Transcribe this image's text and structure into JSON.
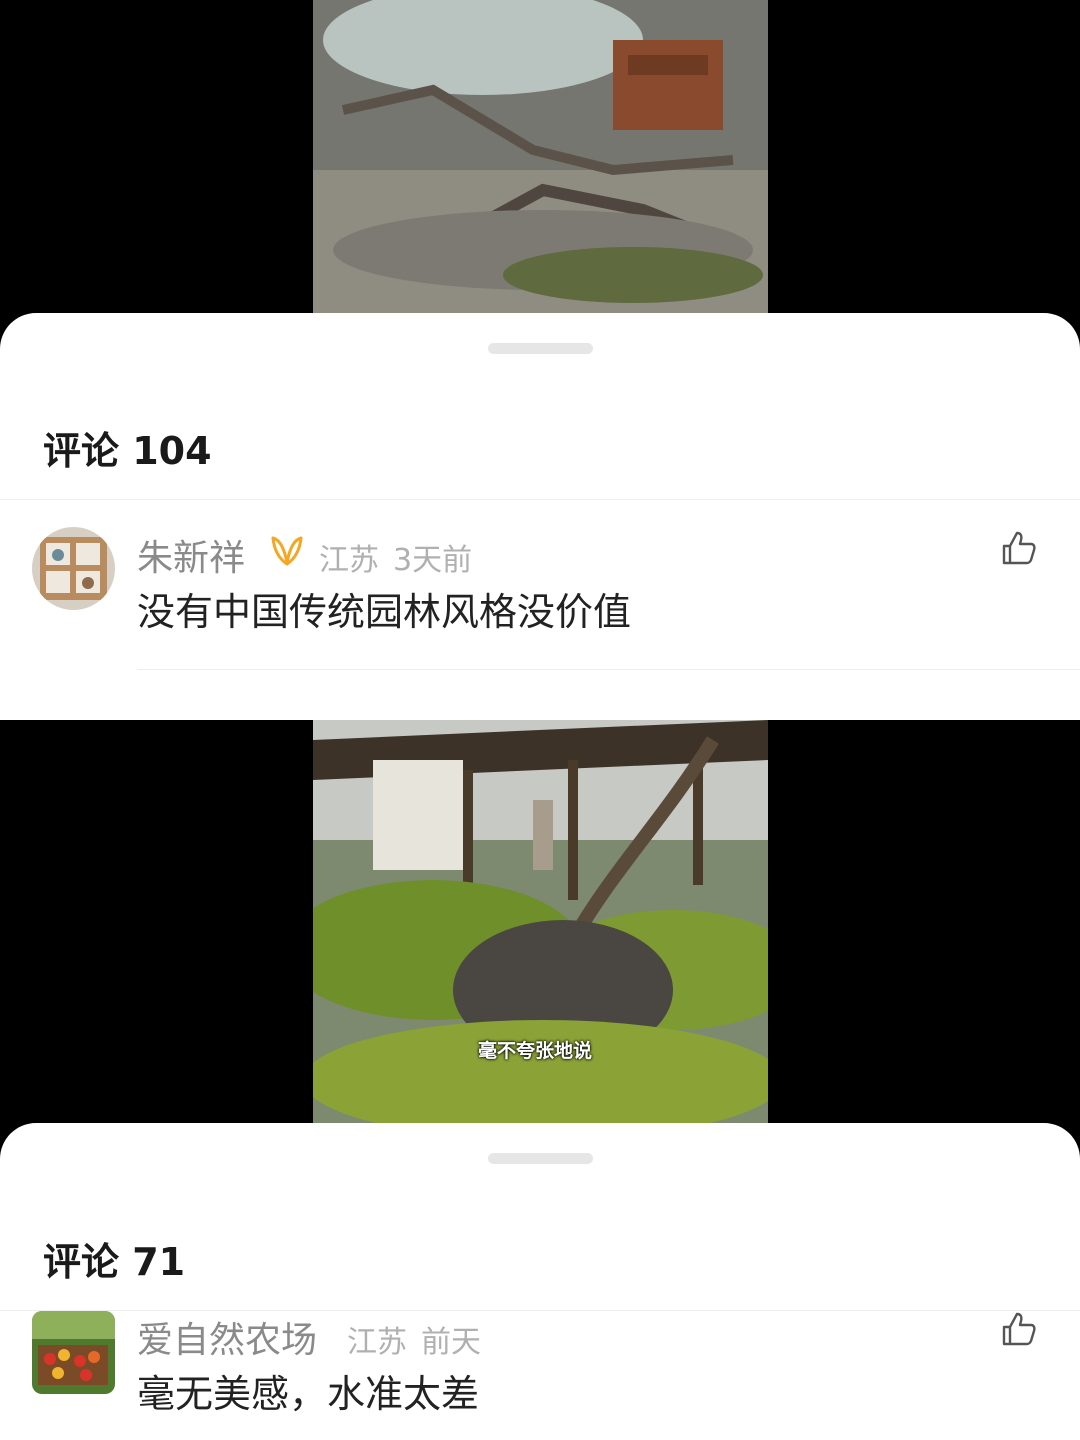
{
  "panel1": {
    "title": "评论 104",
    "comment": {
      "username": "朱新祥",
      "location": "江苏",
      "time": "3天前",
      "text": "没有中国传统园林风格没价值"
    }
  },
  "panel2": {
    "subtitle": "毫不夸张地说",
    "title": "评论 71",
    "comment": {
      "username": "爱自然农场",
      "location": "江苏",
      "time": "前天",
      "text": "毫无美感，水准太差"
    }
  },
  "icons": {
    "badge": "wing-badge-icon",
    "like": "thumbs-up-icon"
  },
  "colors": {
    "badge": "#f5a623",
    "sheet": "#ffffff",
    "backdrop": "#000000"
  }
}
